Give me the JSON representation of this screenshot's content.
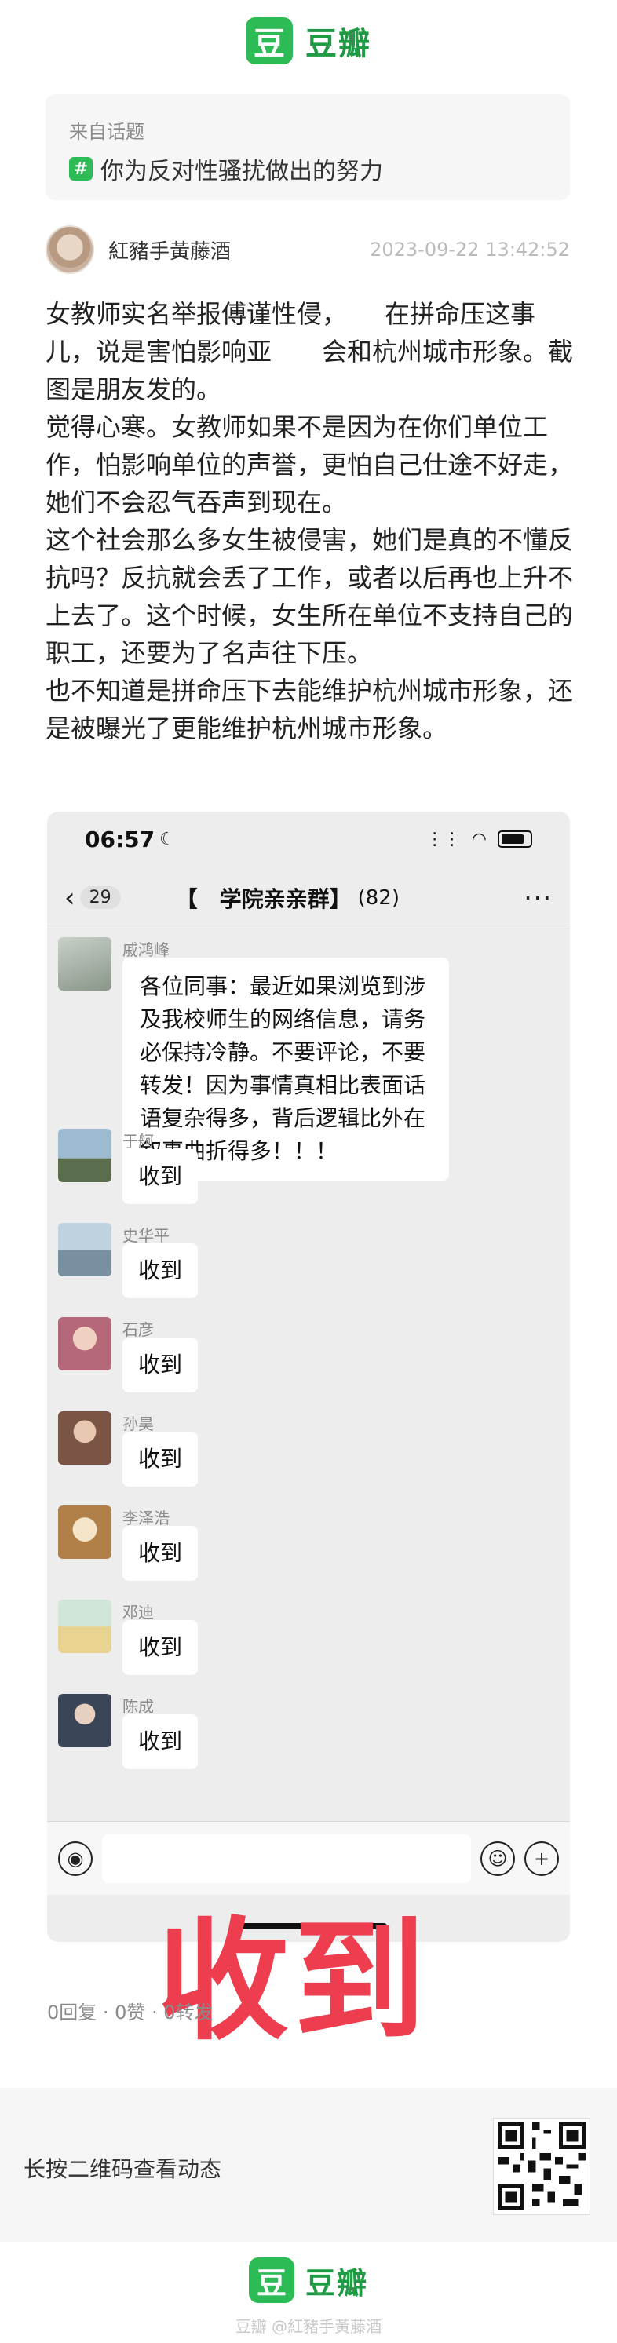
{
  "brand": {
    "logo_glyph": "豆",
    "name": "豆瓣",
    "color": "#2dbb55"
  },
  "topic": {
    "from_label": "来自话题",
    "hash_glyph": "#",
    "title": "你为反对性骚扰做出的努力"
  },
  "author": {
    "name": "紅豬手黃藤酒",
    "time": "2023-09-22 13:42:52"
  },
  "post": {
    "paragraphs": [
      "女教师实名举报傅谨性侵，　　在拼命压这事儿，说是害怕影响亚　　会和杭州城市形象。截图是朋友发的。",
      "觉得心寒。女教师如果不是因为在你们单位工作，怕影响单位的声誉，更怕自己仕途不好走，她们不会忍气吞声到现在。",
      "这个社会那么多女生被侵害，她们是真的不懂反抗吗？反抗就会丢了工作，或者以后再也上升不上去了。这个时候，女生所在单位不支持自己的职工，还要为了名声往下压。",
      "也不知道是拼命压下去能维护杭州城市形象，还是被曝光了更能维护杭州城市形象。"
    ]
  },
  "phone": {
    "status": {
      "time": "06:57",
      "moon_icon": "☾",
      "signal_icon": "⋮⋮",
      "wifi_icon": "◠"
    },
    "chat": {
      "back_icon": "‹",
      "unread": "29",
      "title": "【　学院亲亲群】",
      "count": "(82)",
      "more_icon": "···"
    },
    "messages": [
      {
        "sender": "戚鸿峰",
        "text": "各位同事：最近如果浏览到涉及我校师生的网络信息，请务必保持冷静。不要评论，不要转发！因为事情真相比表面话语复杂得多，背后逻辑比外在叙事曲折得多！！！",
        "avatar_color": "#a8b4a8"
      },
      {
        "sender": "于舸",
        "text": "收到",
        "avatar_color": "#6f8fa8"
      },
      {
        "sender": "史华平",
        "text": "收到",
        "avatar_color": "#9fb6c8"
      },
      {
        "sender": "石彦",
        "text": "收到",
        "avatar_color": "#b47a8a"
      },
      {
        "sender": "孙昊",
        "text": "收到",
        "avatar_color": "#8a6a5a"
      },
      {
        "sender": "李泽浩",
        "text": "收到",
        "avatar_color": "#c4a070"
      },
      {
        "sender": "邓迪",
        "text": "收到",
        "avatar_color": "#a8c8b8"
      },
      {
        "sender": "陈成",
        "text": "收到",
        "avatar_color": "#6a7a8a"
      }
    ],
    "input": {
      "voice_icon": "◉",
      "emoji_icon": "☺",
      "plus_icon": "+"
    }
  },
  "overlay_text": "收到",
  "stats": "0回复 · 0赞 · 0转发",
  "qr": {
    "label": "长按二维码查看动态"
  },
  "footer": {
    "watermark": "豆瓣 @紅豬手黃藤酒"
  }
}
